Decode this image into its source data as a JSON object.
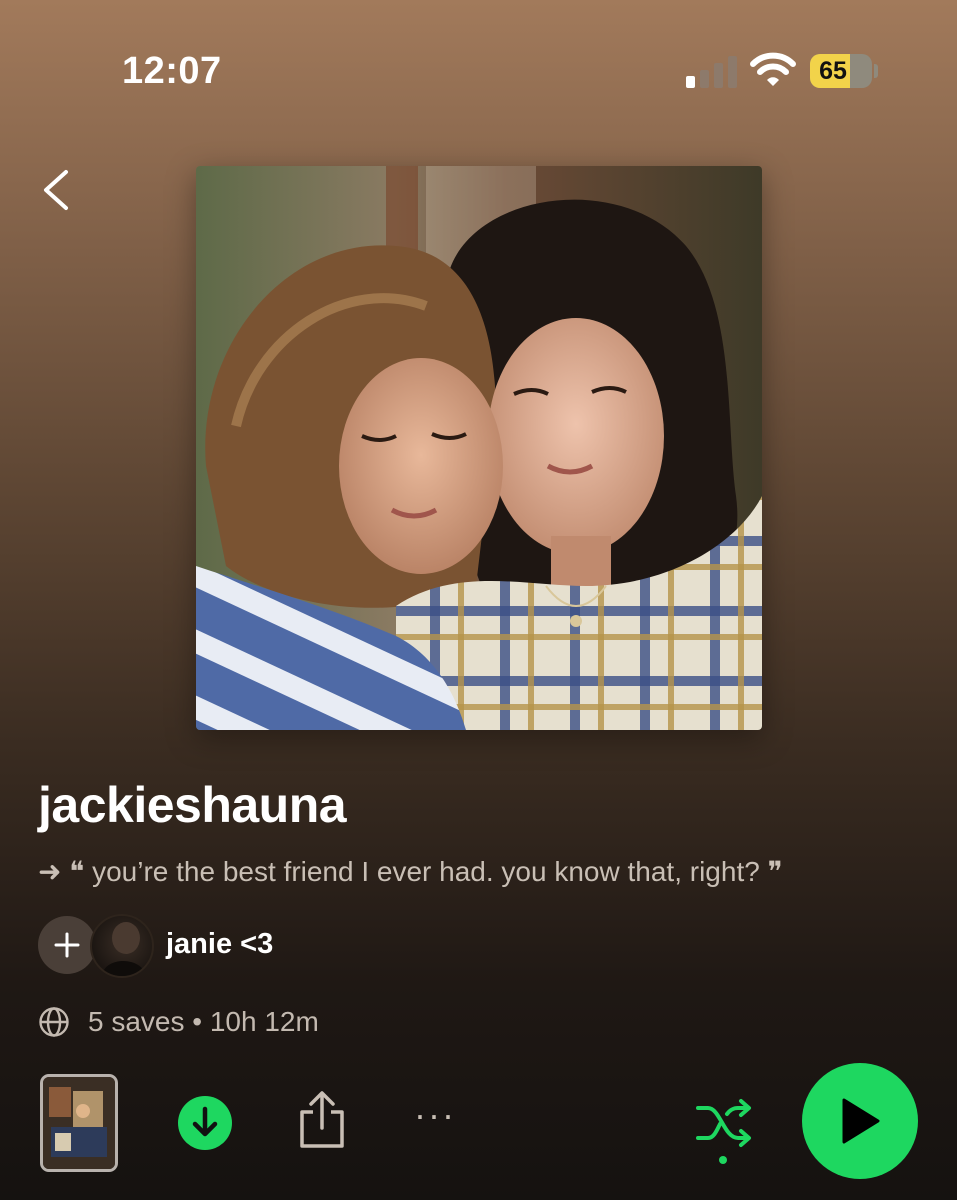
{
  "status_bar": {
    "time": "12:07",
    "battery": "65",
    "battery_level": 0.65,
    "signal_bars_active": 1,
    "signal_bars_total": 4
  },
  "playlist": {
    "title": "jackieshauna",
    "description": "➜ ❝ you’re the best friend I ever had. you know that, right? ❞",
    "owner": "janie <3",
    "meta": "5 saves • 10h 12m"
  },
  "colors": {
    "accent": "#1ed760",
    "background_top": "#a27a5b",
    "background_bottom": "#151210",
    "battery_fill": "#f2d34a"
  },
  "icons": {
    "back": "chevron-left-icon",
    "add": "plus-icon",
    "globe": "globe-icon",
    "download": "download-icon",
    "share": "share-icon",
    "more": "more-icon",
    "shuffle": "shuffle-icon",
    "play": "play-icon"
  },
  "actions": {
    "more_label": "···"
  }
}
